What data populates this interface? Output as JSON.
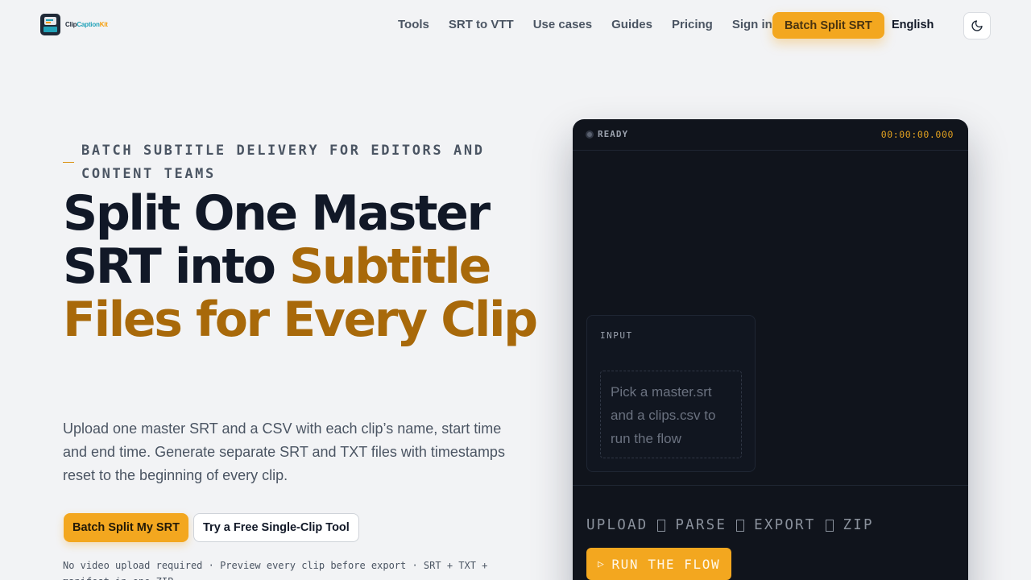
{
  "brand": {
    "name_part1": "Clip",
    "name_part2": "Caption",
    "name_part3": "Kit"
  },
  "nav": {
    "items": [
      {
        "label": "Tools"
      },
      {
        "label": "SRT to VTT"
      },
      {
        "label": "Use cases"
      },
      {
        "label": "Guides"
      },
      {
        "label": "Pricing"
      },
      {
        "label": "Sign in"
      }
    ],
    "cta_label": "Batch Split SRT",
    "language": "English",
    "theme_icon": "moon-icon"
  },
  "hero": {
    "eyebrow": "BATCH SUBTITLE DELIVERY FOR EDITORS AND CONTENT TEAMS",
    "headline_part1": "Split One Master SRT into ",
    "headline_accent": "Subtitle Files for Every Clip",
    "subtext": "Upload one master SRT and a CSV with each clip’s name, start time and end time. Generate separate SRT and TXT files with timestamps reset to the beginning of every clip.",
    "primary_button": "Batch Split My SRT",
    "secondary_button": "Try a Free Single-Clip Tool",
    "fineprint": "No video upload required · Preview every clip before export · SRT + TXT + manifest in one ZIP"
  },
  "panel": {
    "status": "READY",
    "timer": "00:00:00.000",
    "input_label": "INPUT",
    "dropzone_text": "Pick a master.srt and a clips.csv to run the flow",
    "steps": [
      "UPLOAD",
      "PARSE",
      "EXPORT",
      "ZIP"
    ],
    "run_button": "RUN THE FLOW"
  },
  "colors": {
    "accent": "#f3a71f",
    "headline_accent": "#a8690a",
    "panel_bg": "#10141c",
    "timer": "#e0a020"
  }
}
